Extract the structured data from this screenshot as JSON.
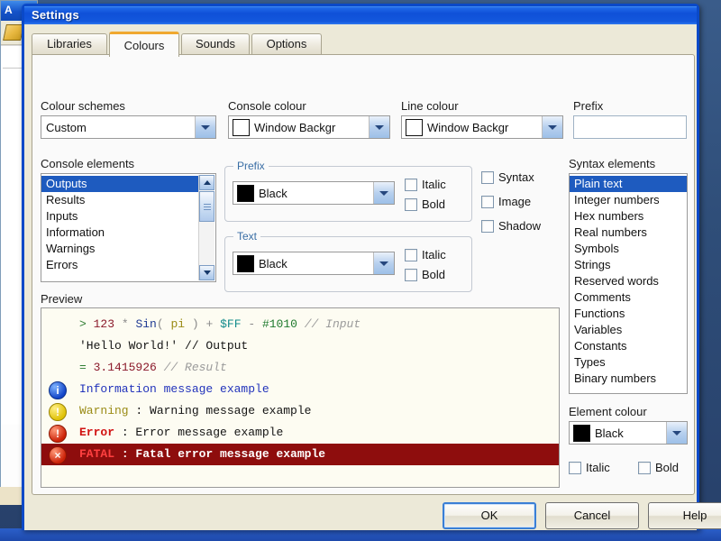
{
  "window": {
    "title": "Settings"
  },
  "tabs": [
    {
      "label": "Libraries",
      "active": false
    },
    {
      "label": "Colours",
      "active": true
    },
    {
      "label": "Sounds",
      "active": false
    },
    {
      "label": "Options",
      "active": false
    }
  ],
  "colour_schemes": {
    "label": "Colour schemes",
    "value": "Custom"
  },
  "console_colour": {
    "label": "Console colour",
    "value": "Window Backgr",
    "swatch": "#ffffff"
  },
  "line_colour": {
    "label": "Line colour",
    "value": "Window Backgr",
    "swatch": "#ffffff"
  },
  "prefix_field": {
    "label": "Prefix",
    "value": "",
    "placeholder": ""
  },
  "console_elements": {
    "label": "Console elements",
    "items": [
      {
        "label": "Outputs",
        "selected": true
      },
      {
        "label": "Results",
        "selected": false
      },
      {
        "label": "Inputs",
        "selected": false
      },
      {
        "label": "Information",
        "selected": false
      },
      {
        "label": "Warnings",
        "selected": false
      },
      {
        "label": "Errors",
        "selected": false
      }
    ]
  },
  "prefix_group": {
    "title": "Prefix",
    "colour": "Black",
    "swatch": "#000000",
    "italic_label": "Italic",
    "bold_label": "Bold",
    "italic_checked": false,
    "bold_checked": false
  },
  "text_group": {
    "title": "Text",
    "colour": "Black",
    "swatch": "#000000",
    "italic_label": "Italic",
    "bold_label": "Bold",
    "italic_checked": false,
    "bold_checked": false
  },
  "display_options": [
    {
      "label": "Syntax",
      "checked": false
    },
    {
      "label": "Image",
      "checked": false
    },
    {
      "label": "Shadow",
      "checked": false
    }
  ],
  "syntax_elements": {
    "label": "Syntax elements",
    "items": [
      {
        "label": "Plain text",
        "selected": true
      },
      {
        "label": "Integer numbers",
        "selected": false
      },
      {
        "label": "Hex numbers",
        "selected": false
      },
      {
        "label": "Real numbers",
        "selected": false
      },
      {
        "label": "Symbols",
        "selected": false
      },
      {
        "label": "Strings",
        "selected": false
      },
      {
        "label": "Reserved words",
        "selected": false
      },
      {
        "label": "Comments",
        "selected": false
      },
      {
        "label": "Functions",
        "selected": false
      },
      {
        "label": "Variables",
        "selected": false
      },
      {
        "label": "Constants",
        "selected": false
      },
      {
        "label": "Types",
        "selected": false
      },
      {
        "label": "Binary numbers",
        "selected": false
      }
    ]
  },
  "element_colour": {
    "label": "Element colour",
    "value": "Black",
    "swatch": "#000000",
    "italic_label": "Italic",
    "bold_label": "Bold",
    "italic_checked": false,
    "bold_checked": false
  },
  "preview": {
    "label": "Preview",
    "background": "#fdfcf2",
    "lines": [
      {
        "icon": "none",
        "tokens": [
          {
            "text": ">",
            "kind": "prefix"
          },
          {
            "text": " 123",
            "kind": "num"
          },
          {
            "text": " *",
            "kind": "op"
          },
          {
            "text": " Sin",
            "kind": "func"
          },
          {
            "text": "(",
            "kind": "op"
          },
          {
            "text": " pi ",
            "kind": "var"
          },
          {
            "text": ")",
            "kind": "op"
          },
          {
            "text": " +",
            "kind": "op"
          },
          {
            "text": " $FF",
            "kind": "hex"
          },
          {
            "text": " -",
            "kind": "op"
          },
          {
            "text": " #1010",
            "kind": "bin"
          },
          {
            "text": " // Input",
            "kind": "cmt"
          }
        ]
      },
      {
        "icon": "none",
        "tokens": [
          {
            "text": "  'Hello World!' // Output",
            "kind": "str"
          }
        ]
      },
      {
        "icon": "none",
        "tokens": [
          {
            "text": "=",
            "kind": "prefix"
          },
          {
            "text": " 3.1415926",
            "kind": "num"
          },
          {
            "text": " // Result",
            "kind": "cmt"
          }
        ]
      },
      {
        "icon": "info",
        "icon_glyph": "i",
        "tokens": [
          {
            "text": "Information message example",
            "kind": "info"
          }
        ]
      },
      {
        "icon": "warn",
        "icon_glyph": "!",
        "tokens": [
          {
            "text": "Warning",
            "kind": "warnpref"
          },
          {
            "text": " : ",
            "kind": "plain"
          },
          {
            "text": "Warning message example",
            "kind": "plain"
          }
        ]
      },
      {
        "icon": "err",
        "icon_glyph": "!",
        "tokens": [
          {
            "text": "Error",
            "kind": "errpref"
          },
          {
            "text": " : ",
            "kind": "plain"
          },
          {
            "text": "Error message example",
            "kind": "plain"
          }
        ]
      },
      {
        "icon": "fatal",
        "icon_glyph": "×",
        "highlight": true,
        "tokens": [
          {
            "text": "FATAL",
            "kind": "fatalpref"
          },
          {
            "text": " : ",
            "kind": "fataltxt"
          },
          {
            "text": "Fatal error message example",
            "kind": "fataltxt"
          }
        ]
      }
    ]
  },
  "buttons": {
    "ok": "OK",
    "cancel": "Cancel",
    "help": "Help"
  }
}
